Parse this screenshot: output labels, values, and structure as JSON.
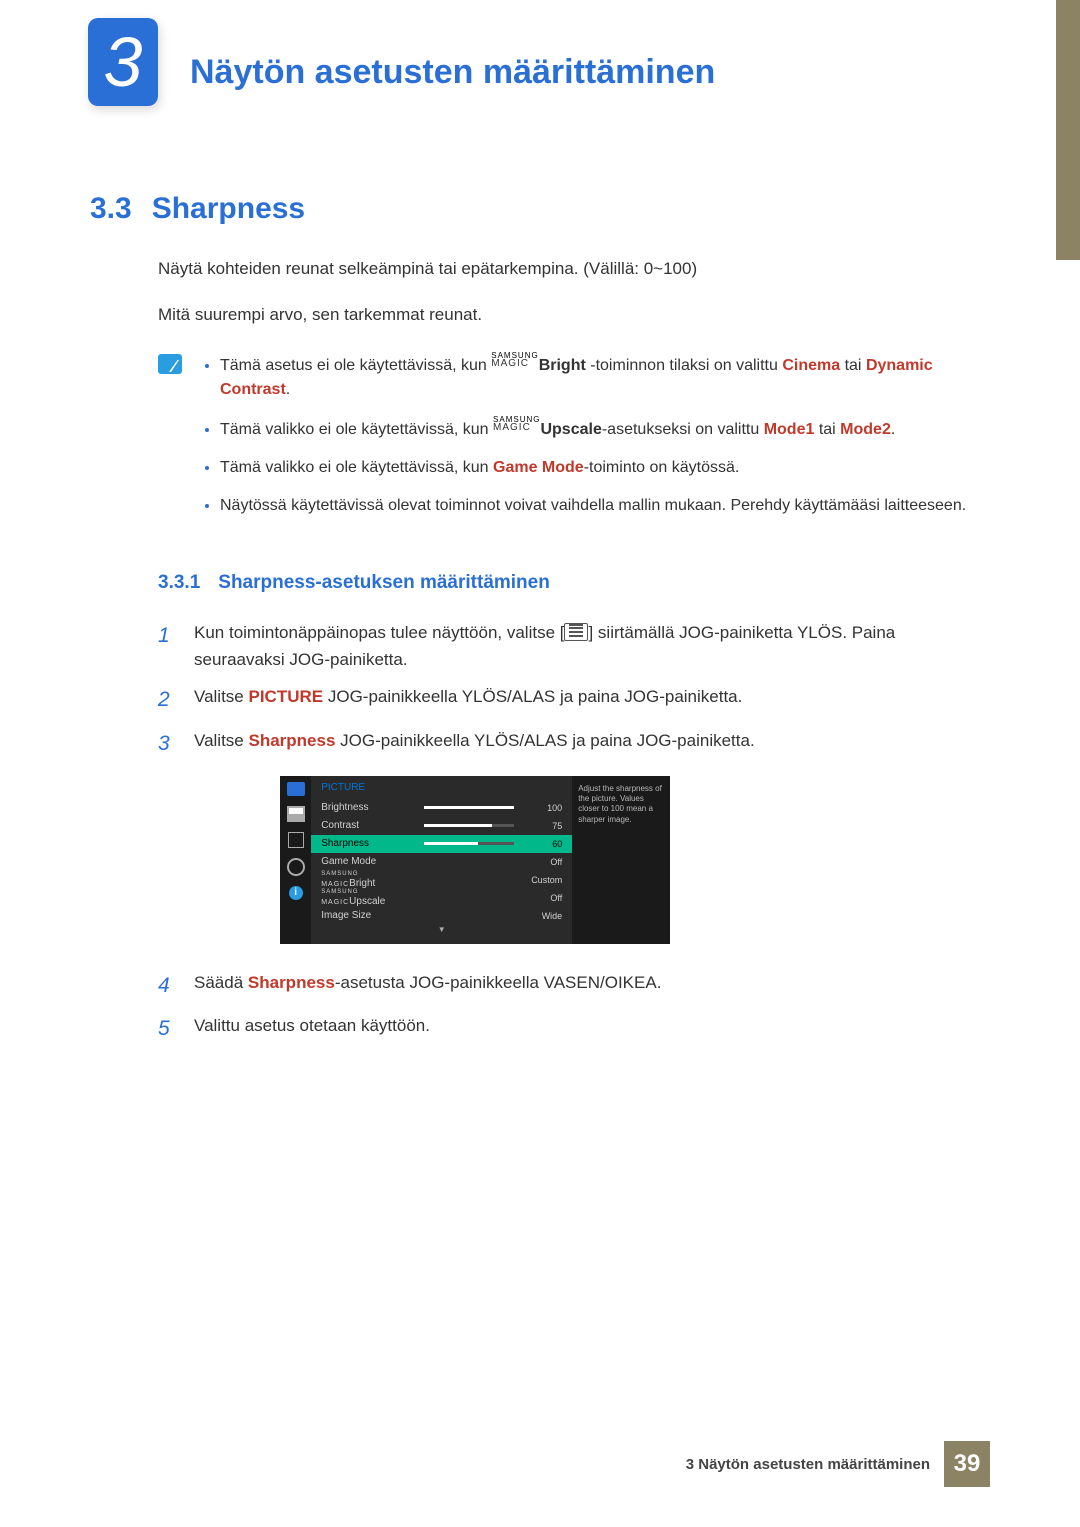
{
  "chapter": {
    "num": "3",
    "title": "Näytön asetusten määrittäminen"
  },
  "section": {
    "num": "3.3",
    "title": "Sharpness"
  },
  "intro": {
    "p1": "Näytä kohteiden reunat selkeämpinä tai epätarkempina. (Välillä: 0~100)",
    "p2": "Mitä suurempi arvo, sen tarkemmat reunat."
  },
  "notes": {
    "n1a": "Tämä asetus ei ole käytettävissä, kun ",
    "n1b": "Bright",
    "n1c": " -toiminnon tilaksi on valittu ",
    "n1d": "Cinema",
    "n1e": " tai ",
    "n1f": "Dynamic Contrast",
    "n1g": ".",
    "n2a": "Tämä valikko ei ole käytettävissä, kun ",
    "n2b": "Upscale",
    "n2c": "-asetukseksi on valittu ",
    "n2d": "Mode1",
    "n2e": " tai ",
    "n2f": "Mode2",
    "n2g": ".",
    "n3a": "Tämä valikko ei ole käytettävissä, kun ",
    "n3b": "Game Mode",
    "n3c": "-toiminto on käytössä.",
    "n4": "Näytössä käytettävissä olevat toiminnot voivat vaihdella mallin mukaan. Perehdy käyttämääsi laitteeseen."
  },
  "subsection": {
    "num": "3.3.1",
    "title": "Sharpness-asetuksen määrittäminen"
  },
  "steps": {
    "s1num": "1",
    "s1a": "Kun toimintonäppäinopas tulee näyttöön, valitse [",
    "s1b": "] siirtämällä JOG-painiketta YLÖS. Paina seuraavaksi JOG-painiketta.",
    "s2num": "2",
    "s2a": "Valitse ",
    "s2b": "PICTURE",
    "s2c": " JOG-painikkeella YLÖS/ALAS ja paina JOG-painiketta.",
    "s3num": "3",
    "s3a": "Valitse ",
    "s3b": "Sharpness",
    "s3c": " JOG-painikkeella YLÖS/ALAS ja paina JOG-painiketta.",
    "s4num": "4",
    "s4a": "Säädä ",
    "s4b": "Sharpness",
    "s4c": "-asetusta JOG-painikkeella VASEN/OIKEA.",
    "s5num": "5",
    "s5": "Valittu asetus otetaan käyttöön."
  },
  "osd": {
    "title": "PICTURE",
    "rows": [
      {
        "label": "Brightness",
        "value": "100",
        "fill": 100,
        "slider": true
      },
      {
        "label": "Contrast",
        "value": "75",
        "fill": 75,
        "slider": true
      },
      {
        "label": "Sharpness",
        "value": "60",
        "fill": 60,
        "slider": true,
        "selected": true
      },
      {
        "label": "Game Mode",
        "value": "Off",
        "slider": false
      },
      {
        "label": "MAGICBright",
        "value": "Custom",
        "slider": false,
        "magic": true
      },
      {
        "label": "MAGICUpscale",
        "value": "Off",
        "slider": false,
        "magic": true
      },
      {
        "label": "Image Size",
        "value": "Wide",
        "slider": false
      }
    ],
    "help": "Adjust the sharpness of the picture. Values closer to 100 mean a sharper image."
  },
  "footer": {
    "text": "3 Näytön asetusten määrittäminen",
    "page": "39"
  },
  "magic": {
    "top": "SAMSUNG",
    "bottom": "MAGIC"
  }
}
